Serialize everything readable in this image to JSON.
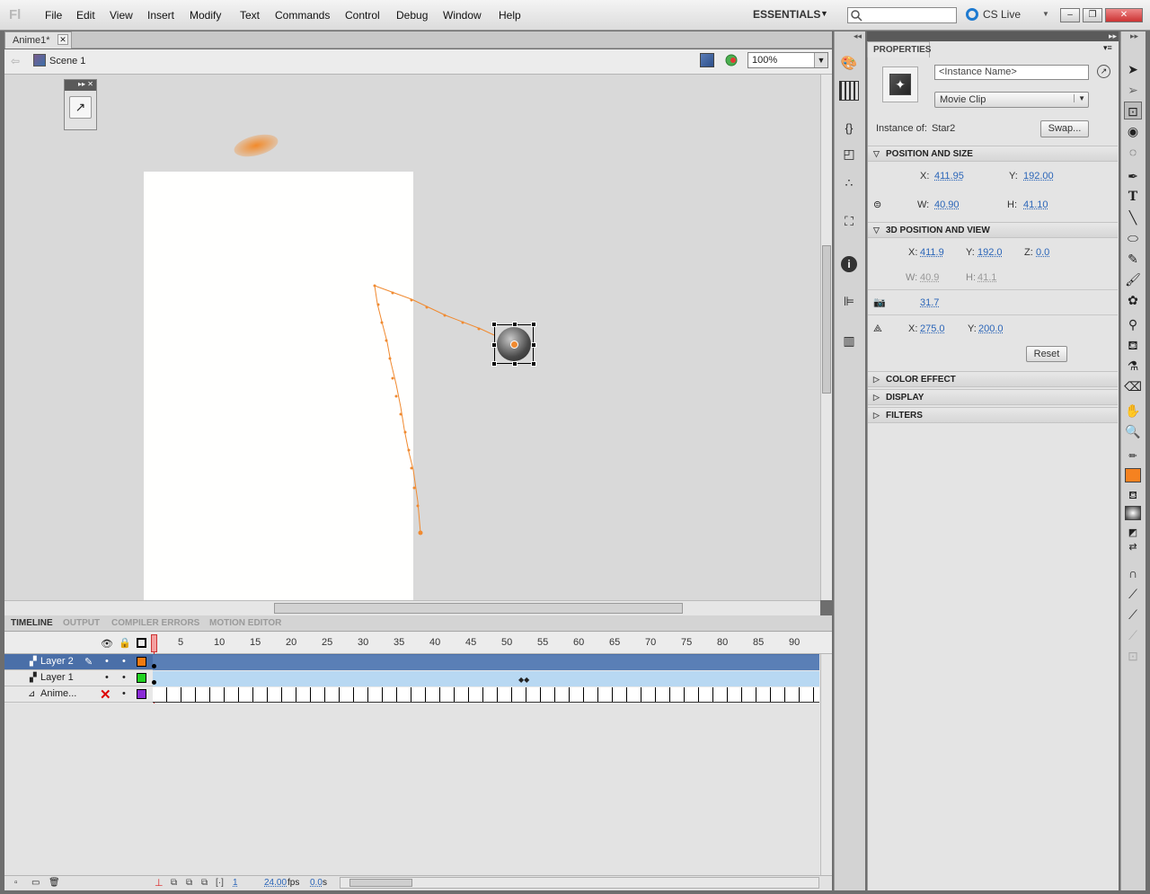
{
  "app": {
    "logo": "Fl"
  },
  "menu": [
    "File",
    "Edit",
    "View",
    "Insert",
    "Modify",
    "Text",
    "Commands",
    "Control",
    "Debug",
    "Window",
    "Help"
  ],
  "workspace": {
    "label": "ESSENTIALS",
    "cslive": "CS Live"
  },
  "document": {
    "tab": "Anime1*",
    "scene": "Scene 1",
    "zoom": "100%"
  },
  "timeline": {
    "tabs": [
      "TIMELINE",
      "OUTPUT",
      "COMPILER ERRORS",
      "MOTION EDITOR"
    ],
    "ruler": [
      "5",
      "10",
      "15",
      "20",
      "25",
      "30",
      "35",
      "40",
      "45",
      "50",
      "55",
      "60",
      "65",
      "70",
      "75",
      "80",
      "85",
      "90"
    ],
    "layers": [
      {
        "name": "Layer 2",
        "color": "#f07a10"
      },
      {
        "name": "Layer 1",
        "color": "#22d322"
      },
      {
        "name": "Anime...",
        "color": "#8a2bd6"
      }
    ],
    "footer": {
      "frame": "1",
      "fps": "24.00",
      "fps_unit": "fps",
      "time": "0.0",
      "time_unit": "s"
    }
  },
  "properties": {
    "tab": "PROPERTIES",
    "instance_placeholder": "<Instance Name>",
    "type": "Movie Clip",
    "instance_of_label": "Instance of:",
    "instance_of": "Star2",
    "swap": "Swap...",
    "pos_size": {
      "title": "POSITION AND SIZE",
      "x_label": "X:",
      "x": "411.95",
      "y_label": "Y:",
      "y": "192.00",
      "w_label": "W:",
      "w": "40.90",
      "h_label": "H:",
      "h": "41.10"
    },
    "pos3d": {
      "title": "3D POSITION AND VIEW",
      "x_label": "X:",
      "x": "411.9",
      "y_label": "Y:",
      "y": "192.0",
      "z_label": "Z:",
      "z": "0.0",
      "w_label": "W:",
      "w": "40.9",
      "h_label": "H:",
      "h": "41.1",
      "fov": "31.7",
      "vx_label": "X:",
      "vx": "275.0",
      "vy_label": "Y:",
      "vy": "200.0",
      "reset": "Reset"
    },
    "collapsed": [
      "COLOR EFFECT",
      "DISPLAY",
      "FILTERS"
    ]
  },
  "colors": {
    "accent": "#2a65b8",
    "selected_layer": "#4a6fa8",
    "motion_path": "#f08a30",
    "fill_swatch": "#f58220"
  }
}
